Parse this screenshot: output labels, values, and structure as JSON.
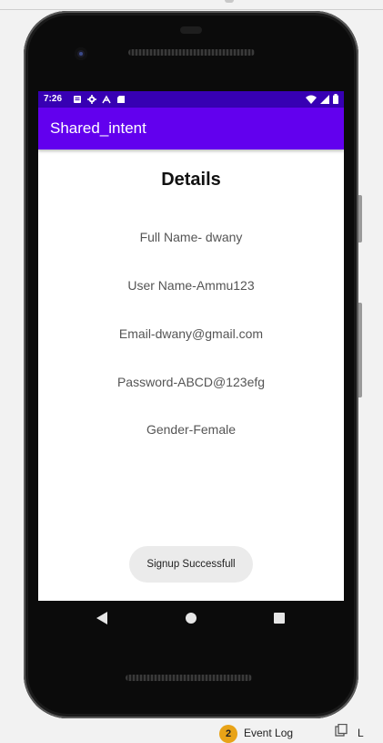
{
  "status_bar": {
    "time": "7:26",
    "left_icons": [
      "notification-icon",
      "settings-icon",
      "usb-debug-icon",
      "sd-card-icon"
    ],
    "right_icons": [
      "wifi-icon",
      "signal-icon",
      "battery-icon"
    ]
  },
  "app_bar": {
    "title": "Shared_intent"
  },
  "details": {
    "heading": "Details",
    "full_name": "Full Name- dwany",
    "user_name": "User Name-Ammu123",
    "email": "Email-dwany@gmail.com",
    "password": "Password-ABCD@123efg",
    "gender": "Gender-Female"
  },
  "toast": {
    "message": "Signup Successfull"
  },
  "nav_bar": {
    "buttons": [
      "back-icon",
      "home-icon",
      "recents-icon"
    ]
  },
  "taskbar": {
    "badge": "2",
    "label": "Event Log",
    "trailing": "L"
  },
  "colors": {
    "status_bar": "#3700b3",
    "app_bar": "#6200ee",
    "screen_bg": "#ffffff"
  }
}
